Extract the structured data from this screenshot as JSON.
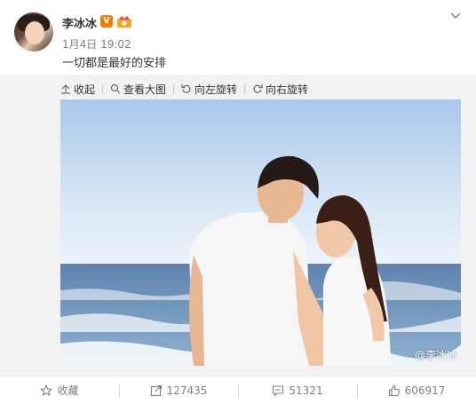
{
  "post": {
    "username": "李冰冰",
    "verified_badge": "V",
    "time": "1月4日 19:02",
    "text": "一切都是最好的安排",
    "avatar_icon": "avatar-photo",
    "more_icon": "chevron-down-icon"
  },
  "media": {
    "tools": [
      {
        "label": "收起",
        "icon": "collapse-arrow-icon"
      },
      {
        "label": "查看大图",
        "icon": "magnifier-icon"
      },
      {
        "label": "向左旋转",
        "icon": "rotate-left-icon"
      },
      {
        "label": "向右旋转",
        "icon": "rotate-right-icon"
      }
    ],
    "watermark": "@李冰冰"
  },
  "actions": [
    {
      "label": "收藏",
      "icon": "star-icon"
    },
    {
      "label": "127435",
      "icon": "share-icon"
    },
    {
      "label": "51321",
      "icon": "comment-icon"
    },
    {
      "label": "606917",
      "icon": "like-icon"
    }
  ],
  "colors": {
    "badge": "#f77b00",
    "muted": "#808080",
    "media_bg": "#f2f2f5",
    "sky_top": "#b9d3ee",
    "sea": "#6f8fb3"
  }
}
